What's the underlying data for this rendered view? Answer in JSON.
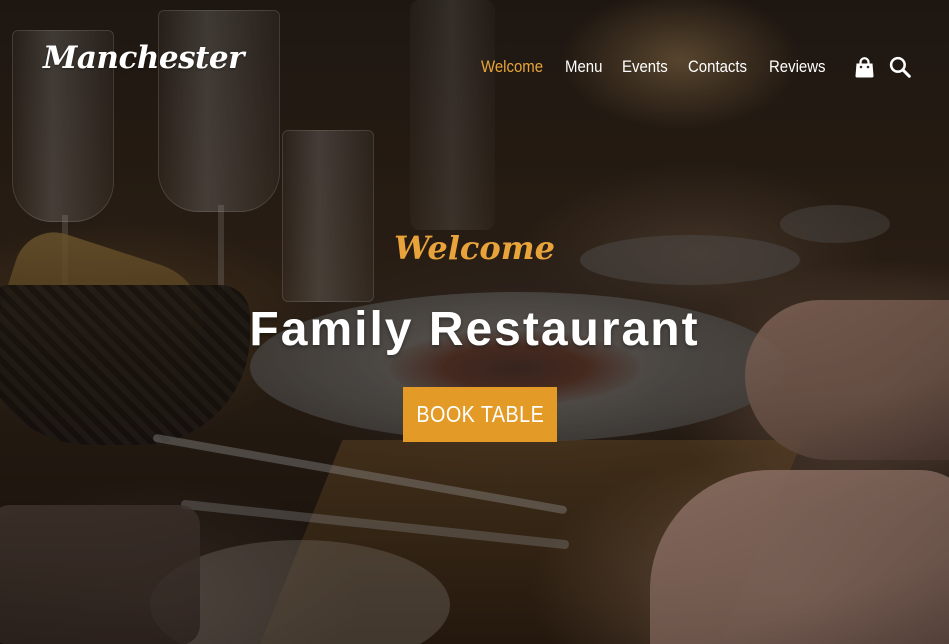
{
  "brand": {
    "logo_text": "Manchester"
  },
  "nav": {
    "items": [
      {
        "label": "Welcome",
        "active": true
      },
      {
        "label": "Menu",
        "active": false
      },
      {
        "label": "Events",
        "active": false
      },
      {
        "label": "Contacts",
        "active": false
      },
      {
        "label": "Reviews",
        "active": false
      }
    ],
    "icons": [
      "shopping-bag-icon",
      "search-icon"
    ]
  },
  "hero": {
    "script_heading": "Welcome",
    "title": "Family Restaurant",
    "cta_label": "BOOK TABLE",
    "background_image": "restaurant-dinner-table-photo"
  },
  "colors": {
    "accent": "#e39a26",
    "nav_active": "#e8a43a",
    "text": "#ffffff"
  }
}
